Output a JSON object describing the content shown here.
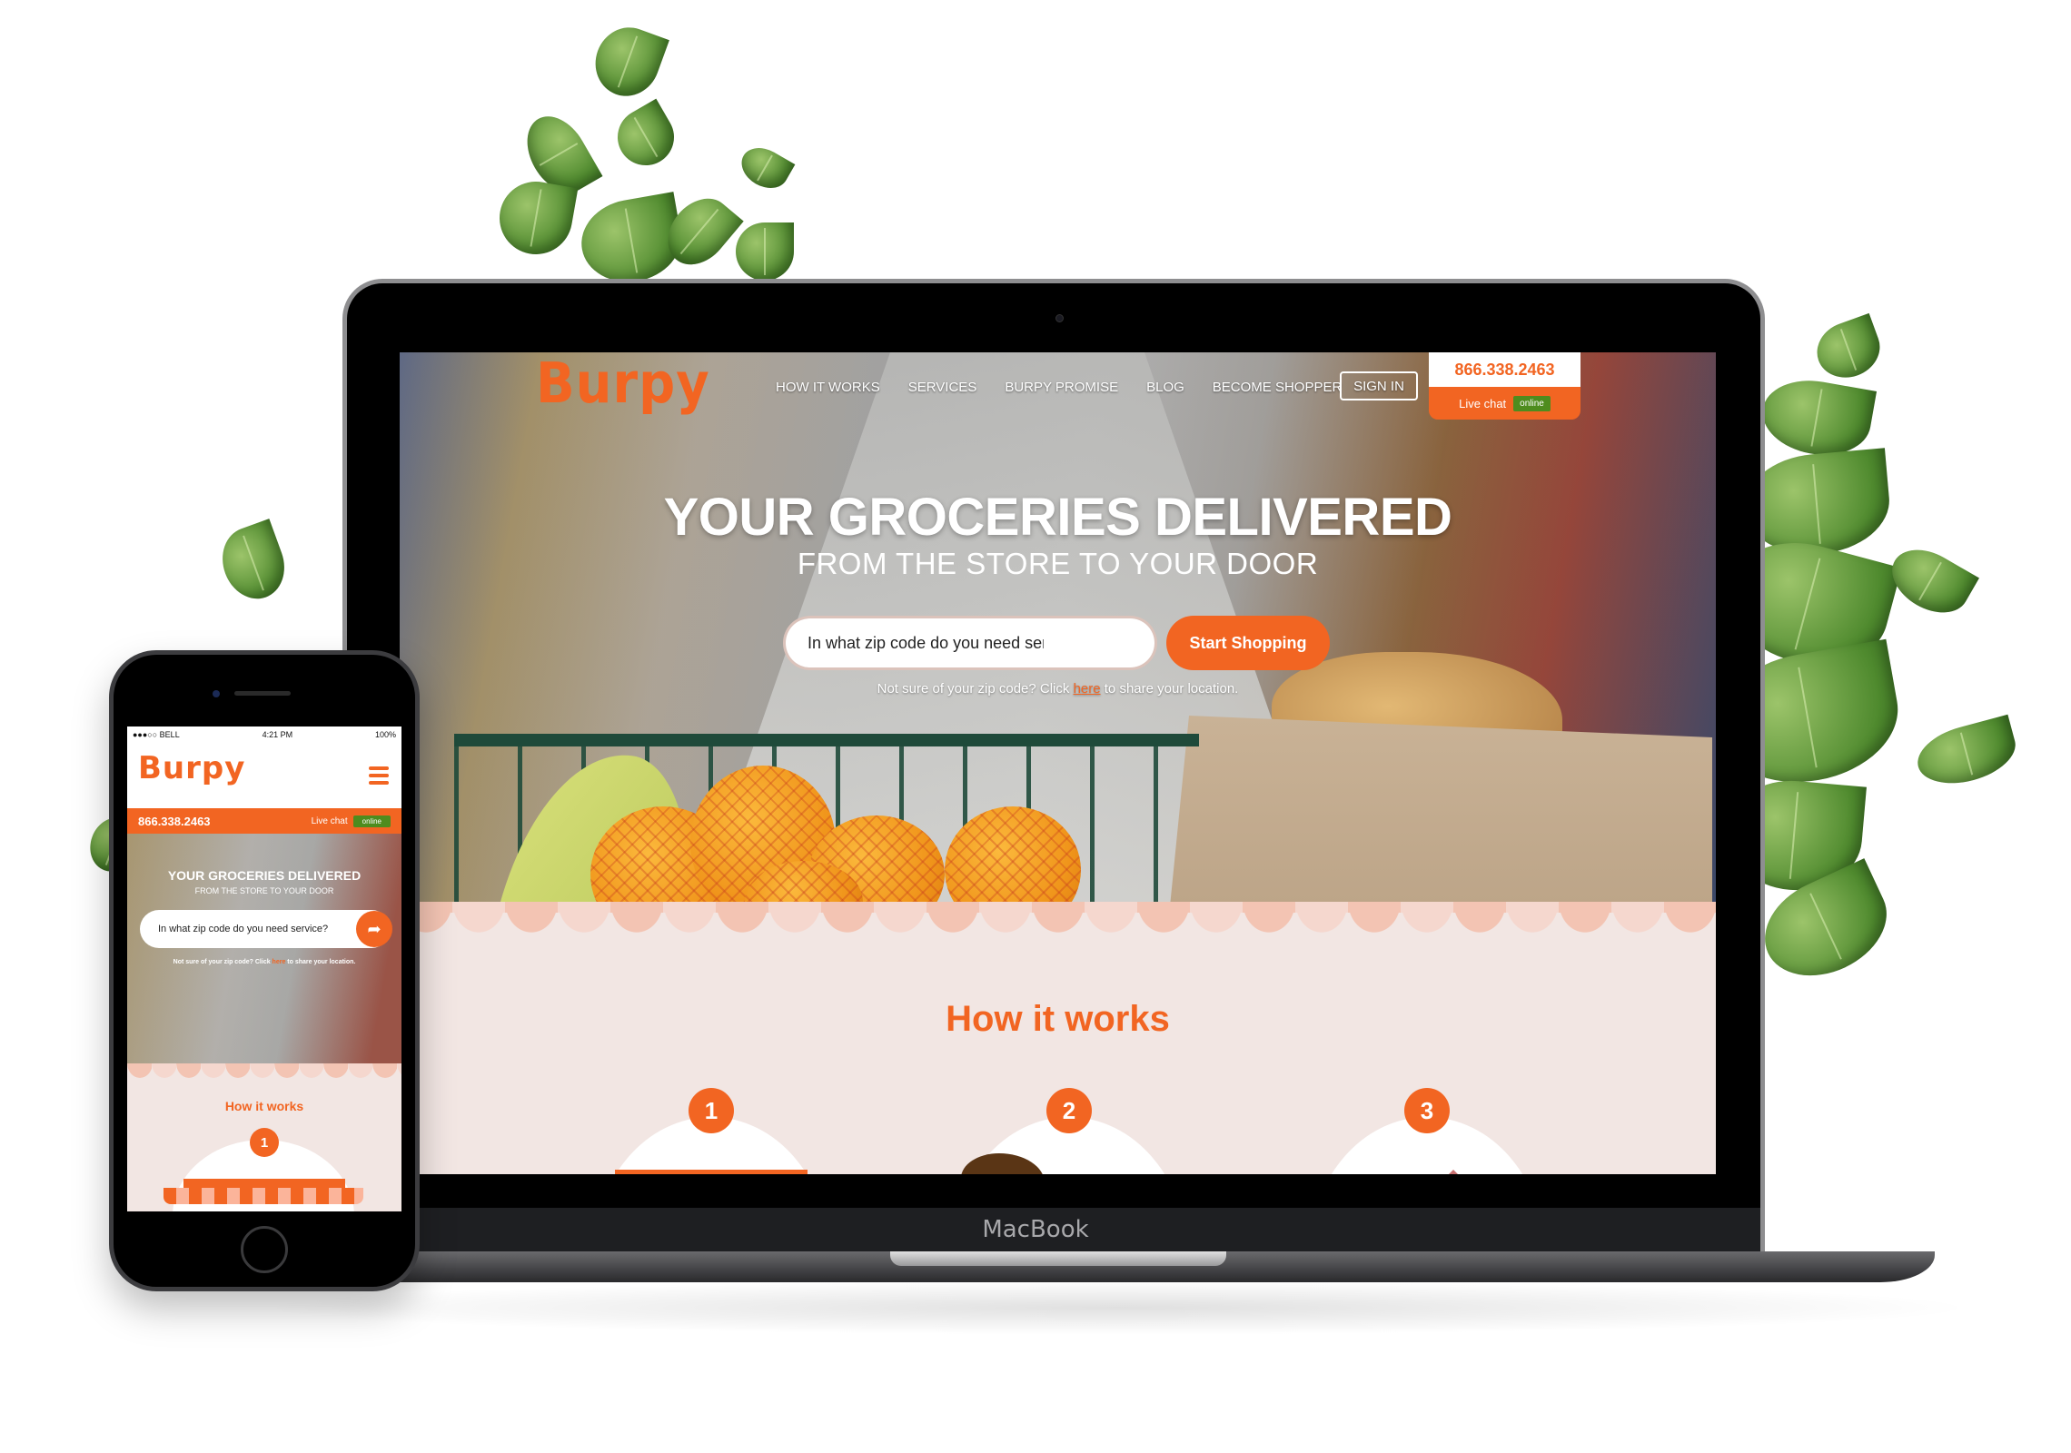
{
  "desktop": {
    "brand": "Burpy",
    "nav": [
      "HOW IT WORKS",
      "SERVICES",
      "BURPY PROMISE",
      "BLOG",
      "BECOME SHOPPER"
    ],
    "sign_in": "SIGN IN",
    "phone": "866.338.2463",
    "live_chat": "Live chat",
    "online": "online",
    "hero_title": "YOUR GROCERIES DELIVERED",
    "hero_subtitle": "FROM THE STORE TO YOUR DOOR",
    "search_placeholder": "In what zip code do you need service?",
    "start_button": "Start Shopping",
    "note_before": "Not sure of your zip code? Click ",
    "note_link": "here",
    "note_after": " to share your location.",
    "how_title": "How it works",
    "steps": [
      "1",
      "2",
      "3"
    ],
    "device_label": "MacBook"
  },
  "mobile": {
    "status": {
      "carrier": "●●●○○ BELL",
      "time": "4:21 PM",
      "battery": "100%"
    },
    "brand": "Burpy",
    "phone": "866.338.2463",
    "live_chat": "Live chat",
    "online": "online",
    "hero_title": "YOUR GROCERIES DELIVERED",
    "hero_subtitle": "FROM THE STORE TO YOUR DOOR",
    "search_placeholder": "In what zip code do you need service?",
    "note_before": "Not sure of your zip code? Click ",
    "note_link": "here",
    "note_after": " to share your location.",
    "how_title": "How it works",
    "step": "1"
  },
  "colors": {
    "brand_orange": "#f26522",
    "online_green": "#4e8c1e",
    "section_bg": "#f2e6e3"
  }
}
